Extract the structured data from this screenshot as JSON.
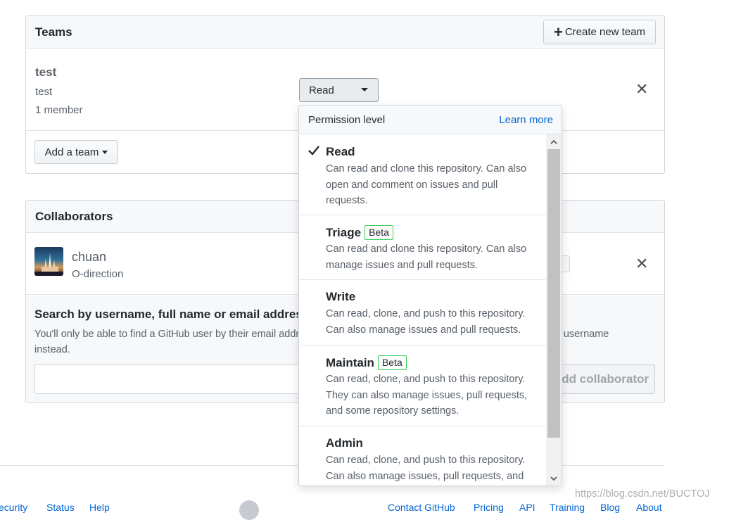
{
  "teams": {
    "title": "Teams",
    "create_button": "Create new team",
    "team": {
      "name": "test",
      "description": "test",
      "members": "1 member",
      "permission": "Read"
    },
    "add_team_button": "Add a team"
  },
  "collaborators": {
    "title": "Collaborators",
    "user": {
      "name": "chuan",
      "org": "O-direction"
    },
    "search_title": "Search by username, full name or email address",
    "search_help_1": "You'll only be able to find a GitHub user by their email address if they've chosen to list it publicly. Otherwise, use their username",
    "search_help_2": "instead.",
    "add_button": "Add collaborator"
  },
  "dropdown": {
    "header": "Permission level",
    "learn_more": "Learn more",
    "items": [
      {
        "title": "Read",
        "beta": "",
        "lines": [
          "Can read and clone this repository. Can also",
          "open and comment on issues and pull",
          "requests."
        ],
        "selected": true
      },
      {
        "title": "Triage",
        "beta": "Beta",
        "lines": [
          "Can read and clone this repository. Can also",
          "manage issues and pull requests."
        ],
        "selected": false
      },
      {
        "title": "Write",
        "beta": "",
        "lines": [
          "Can read, clone, and push to this repository.",
          "Can also manage issues and pull requests."
        ],
        "selected": false
      },
      {
        "title": "Maintain",
        "beta": "Beta",
        "lines": [
          "Can read, clone, and push to this repository.",
          "They can also manage issues, pull requests,",
          "and some repository settings."
        ],
        "selected": false
      },
      {
        "title": "Admin",
        "beta": "",
        "lines": [
          "Can read, clone, and push to this repository.",
          "Can also manage issues, pull requests, and"
        ],
        "selected": false
      }
    ]
  },
  "footer": {
    "left": [
      "ecurity",
      "Status",
      "Help"
    ],
    "right": [
      "Contact GitHub",
      "Pricing",
      "API",
      "Training",
      "Blog",
      "About"
    ]
  },
  "watermark": "https://blog.csdn.net/BUCTOJ",
  "icons": {
    "check": "check-icon",
    "close": "x-icon",
    "plus": "plus-icon",
    "caret": "caret-down-icon"
  },
  "colors": {
    "link": "#0366d6",
    "beta_border": "#34d058"
  }
}
